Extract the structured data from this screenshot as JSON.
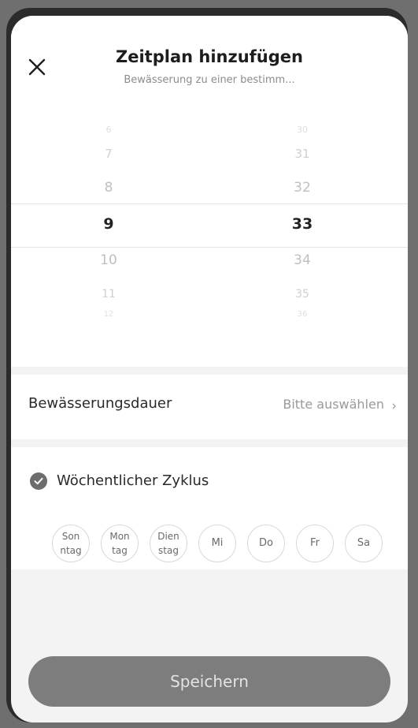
{
  "header": {
    "title": "Zeitplan hinzufügen",
    "subtitle": "Bewässerung zu einer bestimm..."
  },
  "picker": {
    "hours": [
      "6",
      "7",
      "8",
      "9",
      "10",
      "11",
      "12"
    ],
    "minutes": [
      "30",
      "31",
      "32",
      "33",
      "34",
      "35",
      "36"
    ],
    "selected_hour": "9",
    "selected_minute": "33"
  },
  "duration": {
    "label": "Bewässerungsdauer",
    "value": "Bitte auswählen",
    "chevron": "›"
  },
  "weekly": {
    "label": "Wöchentlicher Zyklus",
    "checked": true,
    "days": [
      {
        "line1": "Son",
        "line2": "ntag"
      },
      {
        "line1": "Mon",
        "line2": "tag"
      },
      {
        "line1": "Dien",
        "line2": "stag"
      },
      {
        "line1": "Mi",
        "line2": ""
      },
      {
        "line1": "Do",
        "line2": ""
      },
      {
        "line1": "Fr",
        "line2": ""
      },
      {
        "line1": "Sa",
        "line2": ""
      }
    ]
  },
  "save": {
    "label": "Speichern"
  },
  "icons": {
    "close": "close-icon",
    "check": "check-circle-icon",
    "chevron": "chevron-right-icon"
  },
  "colors": {
    "sheet": "#f3f3f3",
    "button": "#7d7d7d",
    "check": "#6d6d6d"
  }
}
